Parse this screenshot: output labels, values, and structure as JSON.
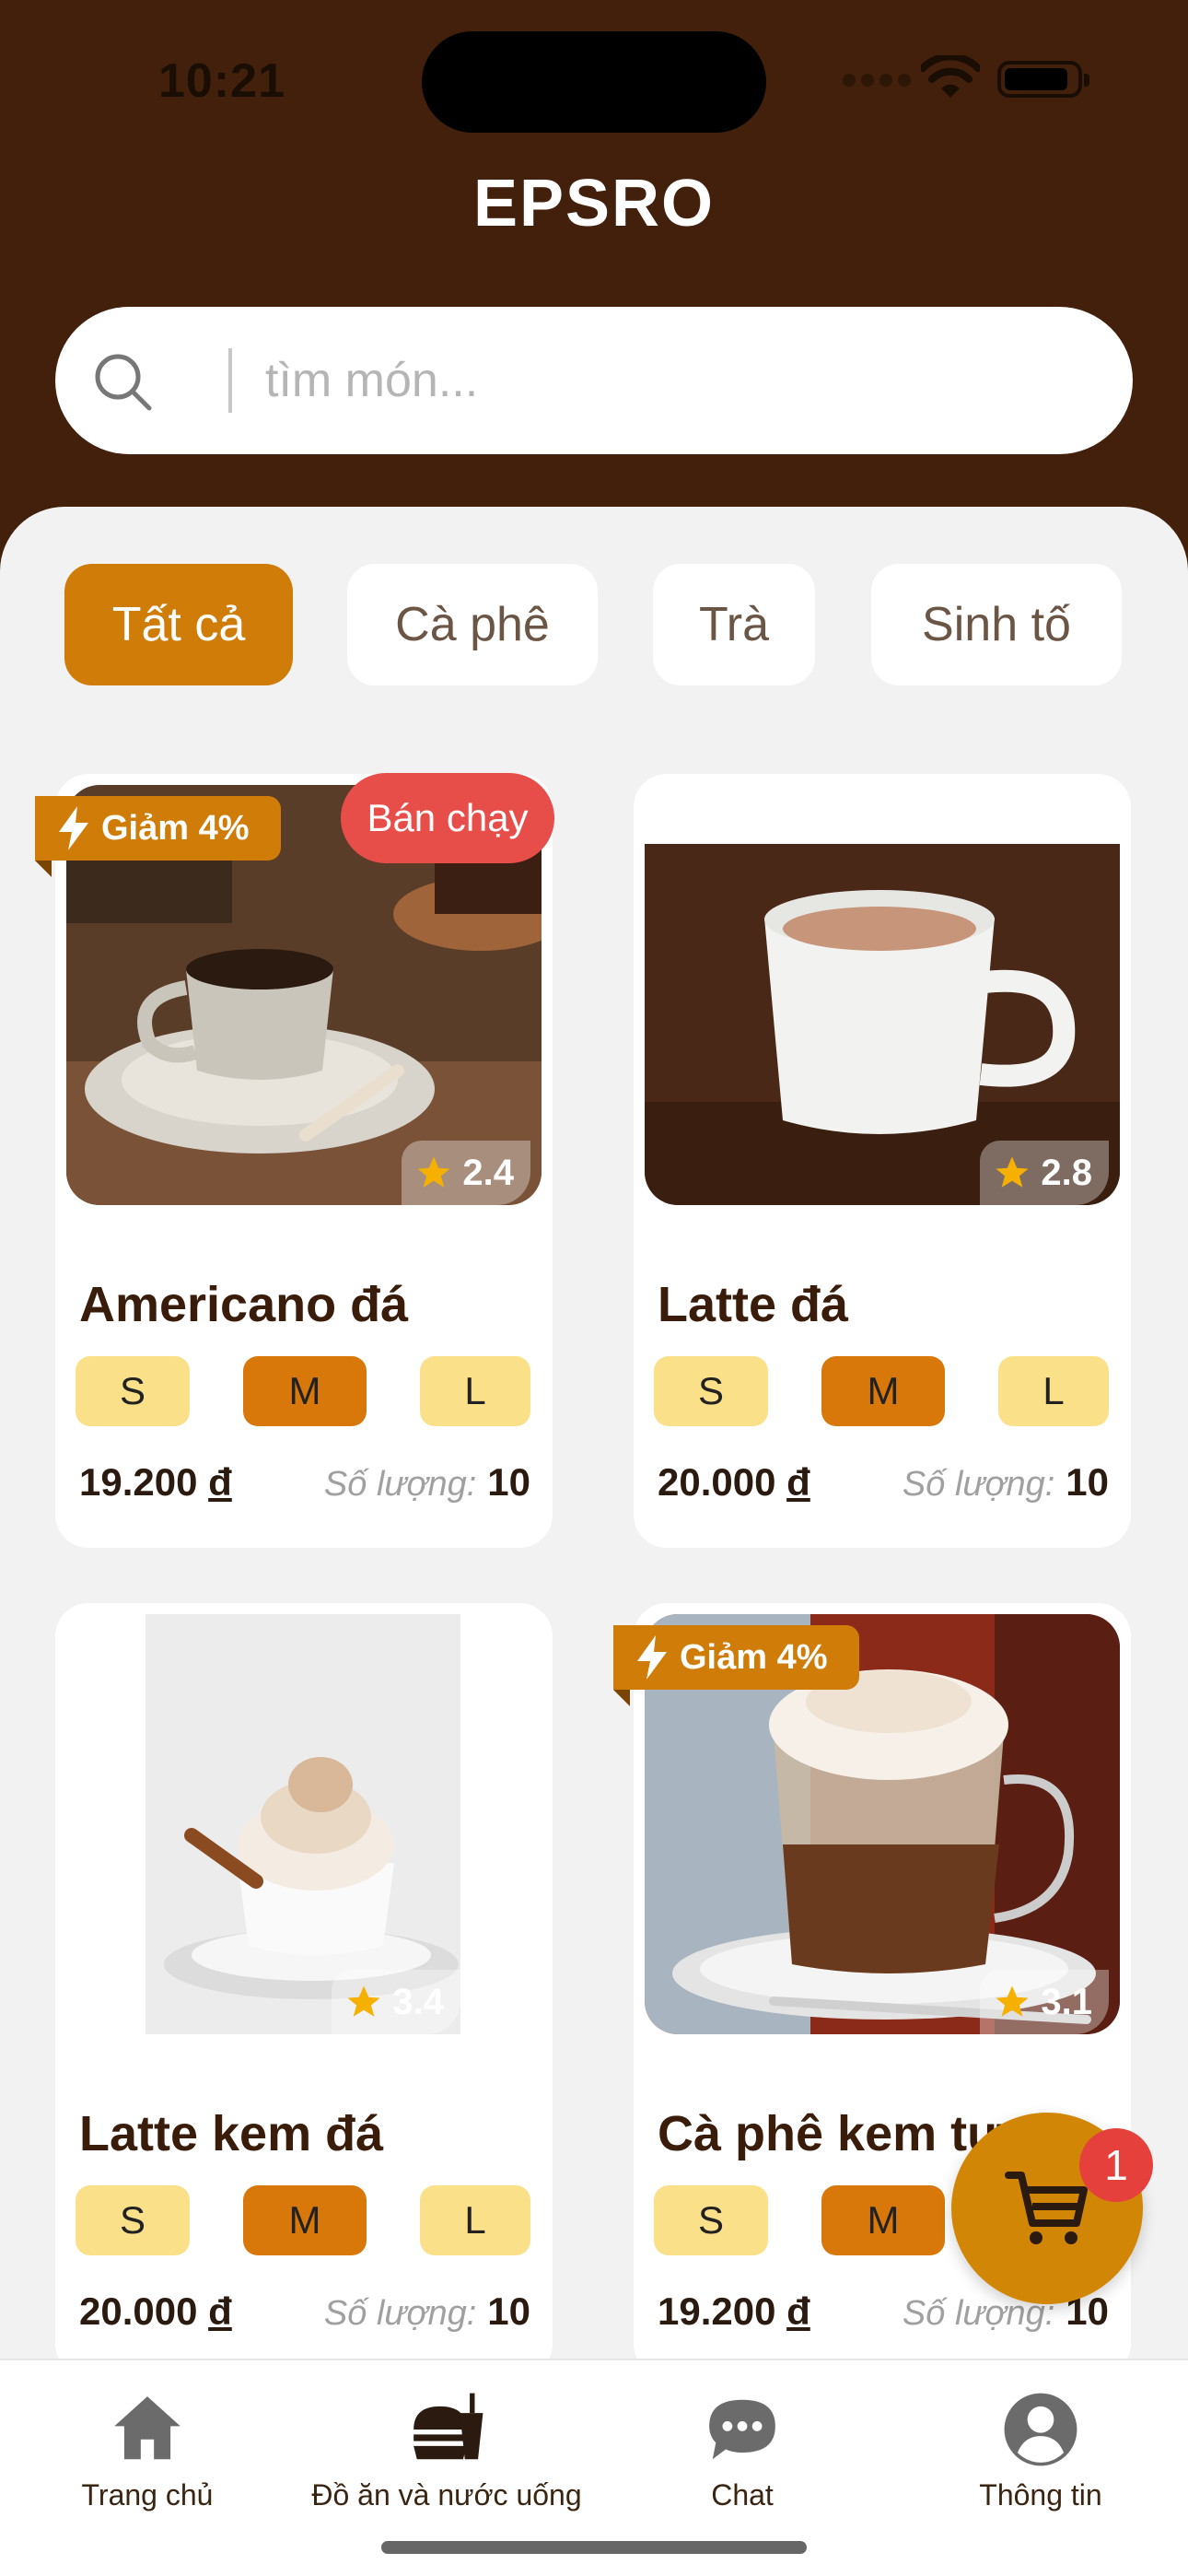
{
  "status_bar": {
    "time": "10:21"
  },
  "header": {
    "title": "EPSRO"
  },
  "search": {
    "placeholder": "tìm món..."
  },
  "categories": [
    {
      "label": "Tất cả",
      "active": true
    },
    {
      "label": "Cà phê",
      "active": false
    },
    {
      "label": "Trà",
      "active": false
    },
    {
      "label": "Sinh tố",
      "active": false
    }
  ],
  "products": [
    {
      "name": "Americano đá",
      "rating": "2.4",
      "discount": "Giảm 4%",
      "badge": "Bán chạy",
      "sizes": [
        "S",
        "M",
        "L"
      ],
      "selected_size": "M",
      "price": "19.200",
      "currency": "đ",
      "qty_label": "Số lượng:",
      "qty": "10"
    },
    {
      "name": "Latte đá",
      "rating": "2.8",
      "sizes": [
        "S",
        "M",
        "L"
      ],
      "selected_size": "M",
      "price": "20.000",
      "currency": "đ",
      "qty_label": "Số lượng:",
      "qty": "10"
    },
    {
      "name": "Latte kem đá",
      "rating": "3.4",
      "sizes": [
        "S",
        "M",
        "L"
      ],
      "selected_size": "M",
      "price": "20.000",
      "currency": "đ",
      "qty_label": "Số lượng:",
      "qty": "10"
    },
    {
      "name": "Cà phê kem tươi",
      "rating": "3.1",
      "discount": "Giảm 4%",
      "sizes": [
        "S",
        "M",
        "L"
      ],
      "selected_size": "M",
      "price": "19.200",
      "currency": "đ",
      "qty_label": "Số lượng:",
      "qty": "10"
    }
  ],
  "cart": {
    "count": "1",
    "icon": "cart-icon"
  },
  "bottom_nav": [
    {
      "label": "Trang chủ",
      "icon": "home-icon"
    },
    {
      "label": "Đồ ăn và nước uống",
      "icon": "food-drink-icon",
      "active": true
    },
    {
      "label": "Chat",
      "icon": "chat-icon"
    },
    {
      "label": "Thông tin",
      "icon": "profile-icon"
    }
  ],
  "colors": {
    "header": "#42200b",
    "accent": "#cf7c08",
    "size_chip": "#fbe08a",
    "size_selected": "#d9780a",
    "bestseller": "#e74e4a",
    "star": "#f5b000"
  }
}
